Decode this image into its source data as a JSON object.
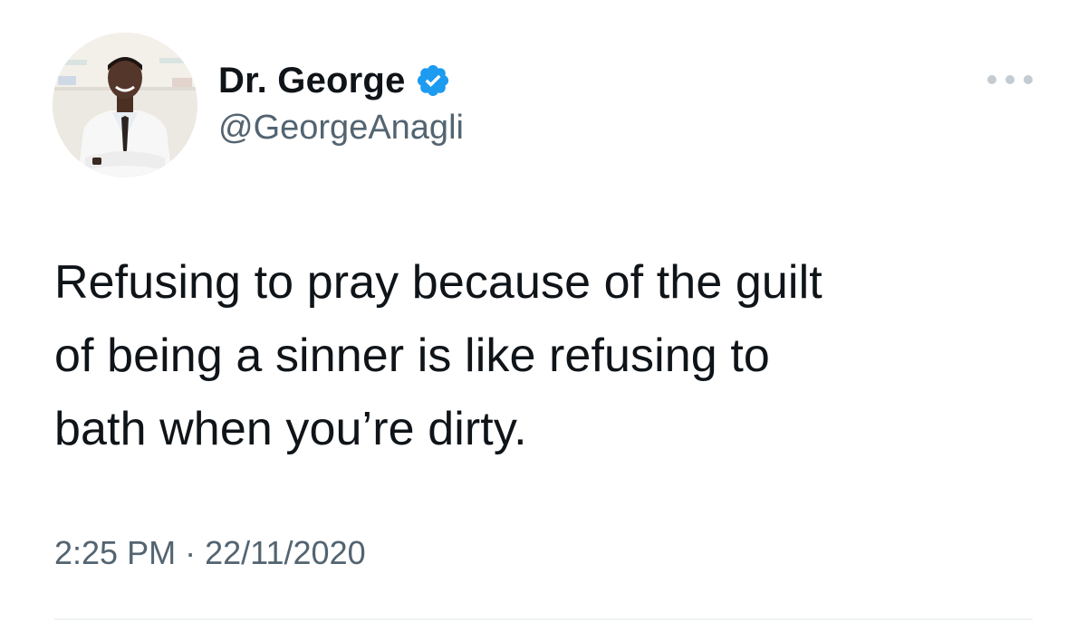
{
  "user": {
    "display_name": "Dr. George",
    "handle": "@GeorgeAnagli",
    "verified": true,
    "verified_icon": "verified-badge-icon",
    "verified_color": "#1d9bf0"
  },
  "more_menu": {
    "icon": "more-horizontal-icon"
  },
  "tweet": {
    "text_lines": [
      "Refusing to pray because of the guilt",
      "of being a sinner is like refusing to",
      "bath when you’re dirty."
    ],
    "time": "2:25 PM",
    "separator": "·",
    "date": "22/11/2020"
  },
  "colors": {
    "text_primary": "#0f1419",
    "text_secondary": "#536471",
    "divider": "#eff3f4"
  }
}
